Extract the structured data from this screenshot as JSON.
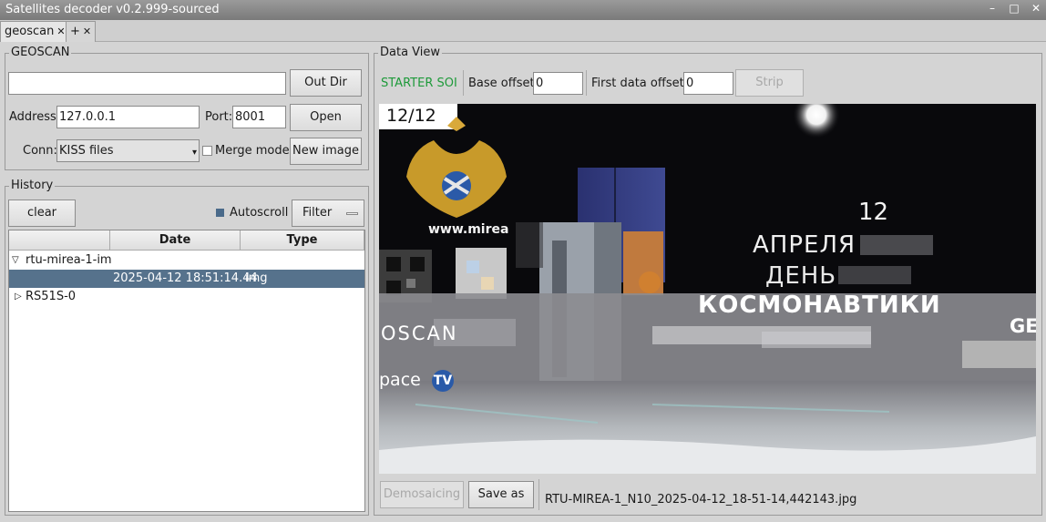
{
  "window": {
    "title": "Satellites decoder v0.2.999-sourced",
    "min": "–",
    "max": "□",
    "close": "✕"
  },
  "tabs": [
    {
      "label": "geoscan",
      "close": "✕"
    },
    {
      "label": "+",
      "close": "✕"
    }
  ],
  "geoscan": {
    "group_title": "GEOSCAN",
    "out_dir_value": "",
    "out_dir_button": "Out Dir",
    "address_label": "Address:",
    "address_value": "127.0.0.1",
    "port_label": "Port:",
    "port_value": "8001",
    "open_button": "Open",
    "conn_label": "Conn:",
    "conn_value": "KISS files",
    "merge_label": "Merge mode",
    "merge_checked": false,
    "new_image_button": "New image"
  },
  "history": {
    "group_title": "History",
    "clear_button": "clear",
    "autoscroll_label": "Autoscroll",
    "filter_button": "Filter",
    "columns": [
      "",
      "Date",
      "Type"
    ],
    "rows": [
      {
        "arrow": "▽",
        "name": "rtu-mirea-1-im",
        "date": "",
        "type": ""
      },
      {
        "arrow": "",
        "name": "",
        "date": "2025-04-12 18:51:14.44",
        "type": "img"
      },
      {
        "arrow": "▷",
        "name": "RS51S-0",
        "date": "",
        "type": ""
      }
    ]
  },
  "data_view": {
    "group_title": "Data View",
    "status": "STARTER SOI",
    "status_color": "#1e9a3a",
    "base_offset_label": "Base offset:",
    "base_offset_value": "0",
    "first_offset_label": "First data offset:",
    "first_offset_value": "0",
    "strip_button": "Strip",
    "demosaicing_button": "Demosaicing",
    "save_as_button": "Save as",
    "filename": "RTU-MIREA-1_N10_2025-04-12_18-51-14,442143.jpg"
  },
  "image": {
    "counter": "12/12",
    "url_text": "www.mirea",
    "day": "12",
    "line1": "АПРЕЛЯ",
    "line2": "ДЕНЬ",
    "line3": "КОСМОНАВТИКИ",
    "band_left": "OSCAN",
    "band_right": "GE",
    "bottom_left": "pace",
    "tv_mark": "TV"
  }
}
